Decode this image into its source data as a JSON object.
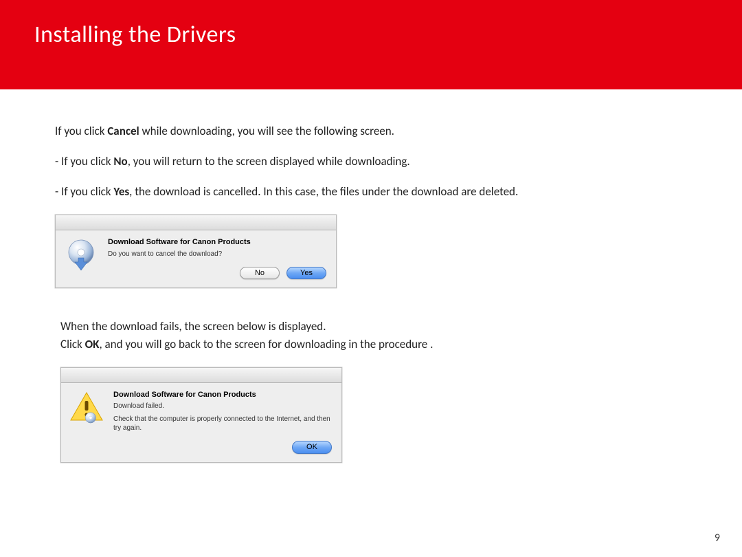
{
  "header": {
    "title": "Installing  the Drivers"
  },
  "body": {
    "intro_pre": "If you click ",
    "intro_bold": "Cancel",
    "intro_post": " while downloading, you will see the following screen.",
    "bullet1_pre": "- If you click ",
    "bullet1_bold": "No",
    "bullet1_post": ", you will return to the screen displayed while downloading.",
    "bullet2_pre": "- If you click ",
    "bullet2_bold": "Yes",
    "bullet2_post": ", the download is cancelled. In this case, the files under the download are deleted.",
    "para2a": "When the download fails, the screen below is displayed.",
    "para2b_pre": "Click ",
    "para2b_bold": "OK",
    "para2b_post": ", and you will go back to the screen for downloading in the procedure ."
  },
  "dialog1": {
    "title": "Download Software for Canon Products",
    "message": "Do you want to cancel the download?",
    "no_label": "No",
    "yes_label": "Yes"
  },
  "dialog2": {
    "title": "Download Software for Canon Products",
    "message": "Download failed.",
    "detail": "Check that the computer is properly connected to the Internet, and then try again.",
    "ok_label": "OK"
  },
  "page_number": "9"
}
